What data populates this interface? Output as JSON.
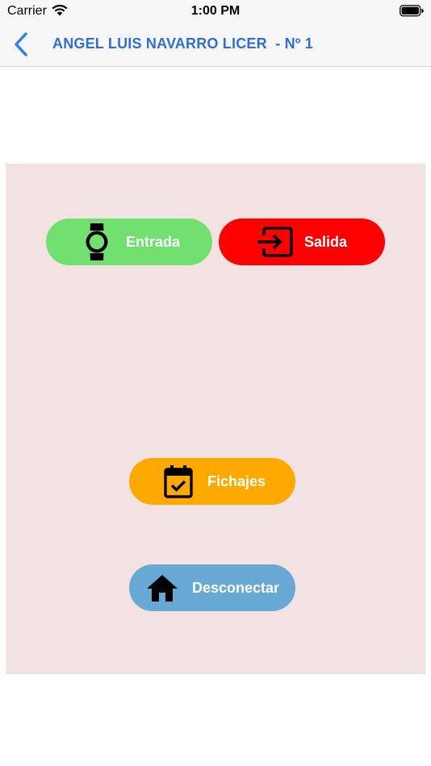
{
  "status_bar": {
    "carrier": "Carrier",
    "time": "1:00 PM"
  },
  "nav": {
    "back_icon": "chevron-left-icon",
    "title": "ANGEL LUIS NAVARRO LICER  - Nº 1",
    "title_color": "#2f6fd6"
  },
  "panel": {
    "background": "#f2e2e2"
  },
  "buttons": {
    "entrada": {
      "label": "Entrada",
      "icon": "watch-icon",
      "color": "#72e06f"
    },
    "salida": {
      "label": "Salida",
      "icon": "exit-icon",
      "color": "#fe0000"
    },
    "fichajes": {
      "label": "Fichajes",
      "icon": "calendar-check-icon",
      "color": "#fea900"
    },
    "desconectar": {
      "label": "Desconectar",
      "icon": "home-icon",
      "color": "#67a8d5"
    }
  }
}
